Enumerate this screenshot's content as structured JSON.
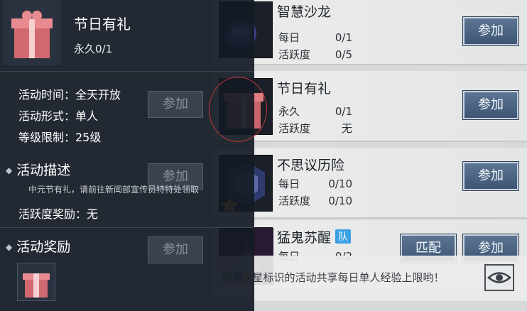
{
  "panel": {
    "title": "节日有礼",
    "subtitle": "永久0/1",
    "time_line": "活动时间：全天开放",
    "form_line": "活动形式：单人",
    "level_line": "等级限制：25级",
    "desc_section": "活动描述",
    "desc_text": "中元节有礼，请前往新闻部宣传员特特处领取",
    "active_reward_line": "活跃度奖励：无",
    "reward_section": "活动奖励"
  },
  "ghost": {
    "join_label": "参加"
  },
  "activities": [
    {
      "name": "智慧沙龙",
      "k1": "每日",
      "v1": "0/1",
      "k2": "活跃度",
      "v2": "0/5",
      "join": "参加"
    },
    {
      "name": "节日有礼",
      "k1": "永久",
      "v1": "0/1",
      "k2": "活跃度",
      "v2": "无",
      "join": "参加"
    },
    {
      "name": "不思议历险",
      "k1": "每日",
      "v1": "0/10",
      "k2": "活跃度",
      "v2": "0/10",
      "join": "参加"
    },
    {
      "name": "猛鬼苏醒",
      "badge": "队",
      "k1": "每日",
      "v1": "0/2",
      "join": "参加",
      "match": "匹配"
    }
  ],
  "footer": {
    "prefix": "带有",
    "tip": "星标识的活动共享每日单人经验上限哟！"
  },
  "colors": {
    "button": "#4a6384",
    "panel": "#141a24",
    "badge": "#3aa0e6"
  }
}
